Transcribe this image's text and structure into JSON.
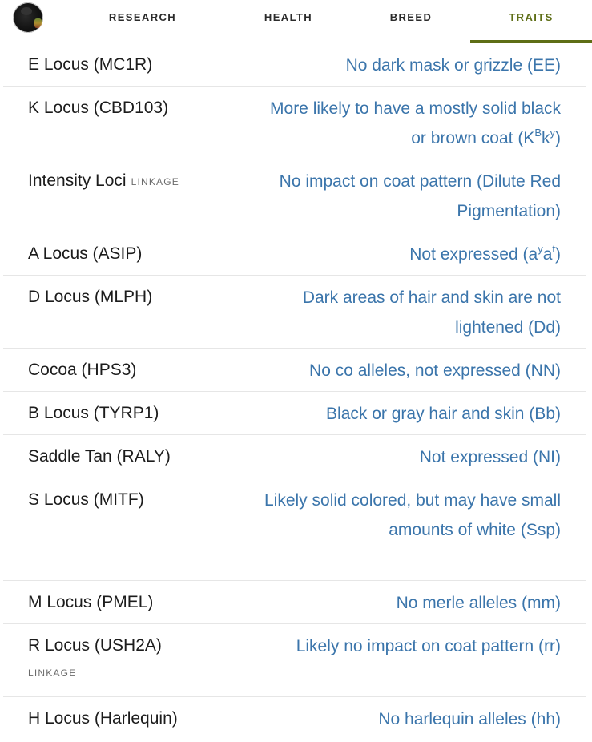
{
  "nav": {
    "tabs": [
      {
        "label": "RESEARCH"
      },
      {
        "label": "HEALTH"
      },
      {
        "label": "BREED"
      },
      {
        "label": "TRAITS",
        "active": true
      }
    ]
  },
  "traits": [
    {
      "name": "E Locus (MC1R)",
      "result": "No dark mask or grizzle (EE)"
    },
    {
      "name": "K Locus (CBD103)",
      "result_pre": "More likely to have a mostly solid black or brown coat (K",
      "sup1": "B",
      "result_mid": "k",
      "sup2": "y",
      "result_post": ")"
    },
    {
      "name": "Intensity Loci",
      "tag": "LINKAGE",
      "result": "No impact on coat pattern (Dilute Red Pigmentation)"
    },
    {
      "name": "A Locus (ASIP)",
      "result_pre": "Not expressed (a",
      "sup1": "y",
      "result_mid": "a",
      "sup2": "t",
      "result_post": ")"
    },
    {
      "name": "D Locus (MLPH)",
      "result": "Dark areas of hair and skin are not lightened (Dd)"
    },
    {
      "name": "Cocoa (HPS3)",
      "result": "No co alleles, not expressed (NN)"
    },
    {
      "name": "B Locus (TYRP1)",
      "result": "Black or gray hair and skin (Bb)"
    },
    {
      "name": "Saddle Tan (RALY)",
      "result": "Not expressed (NI)"
    },
    {
      "name": "S Locus (MITF)",
      "result": "Likely solid colored, but may have small amounts of white (Ssp)"
    },
    {
      "name": "M Locus (PMEL)",
      "result": "No merle alleles (mm)"
    },
    {
      "name": "R Locus (USH2A)",
      "tag": "LINKAGE",
      "result": "Likely no impact on coat pattern (rr)"
    },
    {
      "name": "H Locus (Harlequin)",
      "result": "No harlequin alleles (hh)"
    }
  ],
  "colors": {
    "accent": "#5e6e16",
    "result": "#3b75ab",
    "divider": "#e6e6e6"
  },
  "icons": {
    "avatar": "dog-avatar-icon"
  }
}
